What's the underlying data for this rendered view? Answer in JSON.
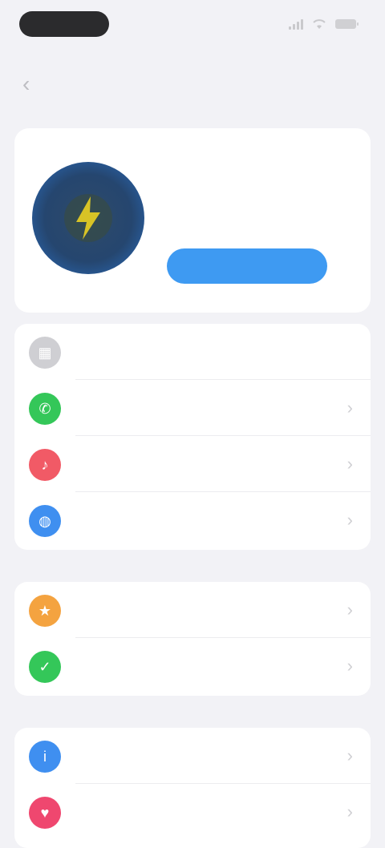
{
  "status_bar": {
    "time": "",
    "cell_bars": 4
  },
  "nav": {
    "back_glyph": "‹",
    "title": "",
    "action": ""
  },
  "hero": {
    "app_name": "",
    "subtitle": "",
    "button_label": "",
    "icon": "bolt-badge-icon",
    "icon_colors": {
      "ring": "#2c6fc2",
      "core": "#25466f",
      "bolt": "#d8c326"
    }
  },
  "groups": [
    {
      "header_item": {
        "label": "",
        "icon": "grid-icon",
        "color": "#cfcfd3"
      },
      "items": [
        {
          "label": "",
          "value": "",
          "icon": "phone-icon",
          "color": "#34c759"
        },
        {
          "label": "",
          "value": "",
          "icon": "bell-icon",
          "color": "#f15a66"
        },
        {
          "label": "",
          "value": "",
          "icon": "globe-icon",
          "color": "#3f8ff0"
        }
      ]
    },
    {
      "items": [
        {
          "label": "",
          "value": "",
          "icon": "star-icon",
          "color": "#f4a340"
        },
        {
          "label": "",
          "value": "",
          "icon": "check-icon",
          "color": "#34c759"
        }
      ]
    },
    {
      "items": [
        {
          "label": "",
          "value": "",
          "icon": "info-icon",
          "color": "#3f8ff0"
        },
        {
          "label": "",
          "value": "",
          "icon": "heart-icon",
          "color": "#ef476f"
        }
      ]
    }
  ]
}
